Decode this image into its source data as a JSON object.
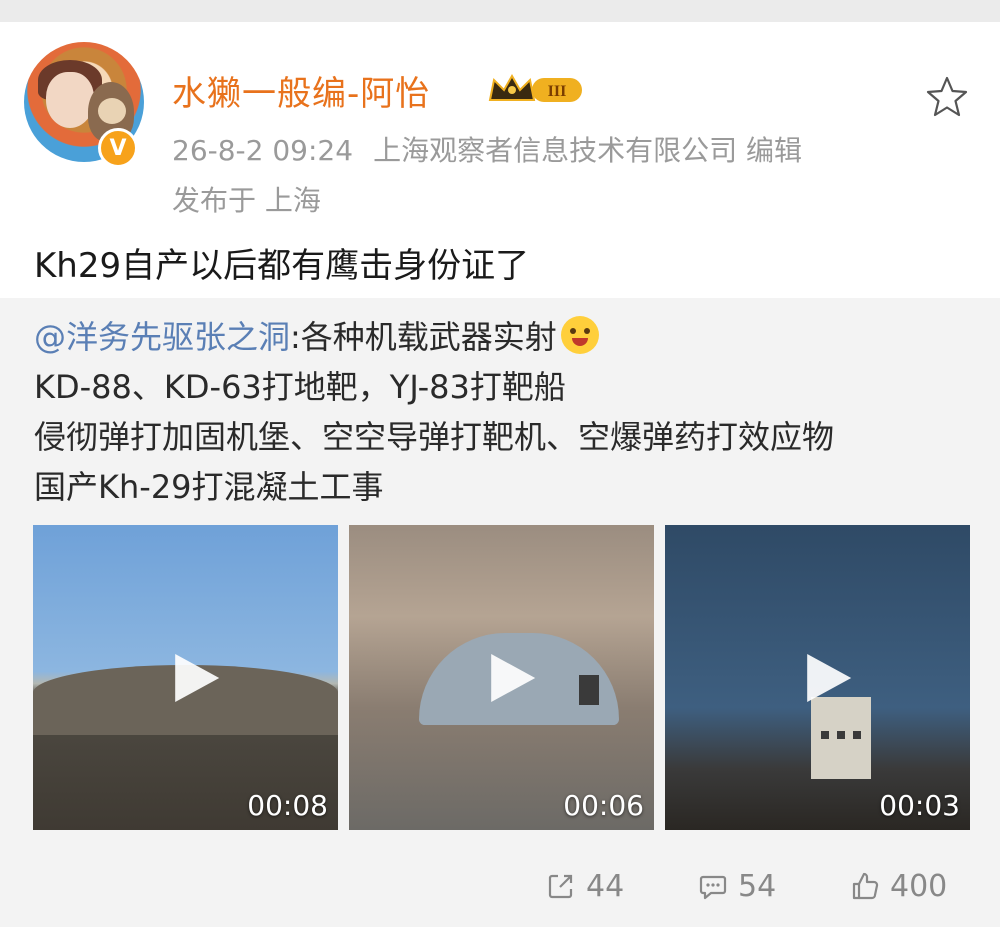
{
  "user": {
    "name": "水獭一般编-阿怡",
    "verified_mark": "V",
    "level_badge": "III",
    "post_time": "26-8-2 09:24",
    "source": "上海观察者信息技术有限公司",
    "edited": "编辑",
    "location": "发布于 上海"
  },
  "post": {
    "text": "Kh29自产以后都有鹰击身份证了"
  },
  "repost": {
    "mention": "@洋务先驱张之洞",
    "line1_rest": ":各种机载武器实射",
    "line2": "KD-88、KD-63打地靶，YJ-83打靶船",
    "line3": "侵彻弹打加固机堡、空空导弹打靶机、空爆弹药打效应物",
    "line4": "国产Kh-29打混凝土工事",
    "videos": [
      {
        "duration": "00:08"
      },
      {
        "duration": "00:06"
      },
      {
        "duration": "00:03"
      }
    ]
  },
  "actions": {
    "share_count": "44",
    "comment_count": "54",
    "like_count": "400"
  },
  "colors": {
    "username": "#e8721c",
    "mention": "#5a7fb5",
    "meta": "#9a9a9a"
  },
  "icons": [
    "star-icon",
    "share-icon",
    "comment-icon",
    "like-icon",
    "play-icon",
    "crown-icon",
    "verified-icon"
  ]
}
